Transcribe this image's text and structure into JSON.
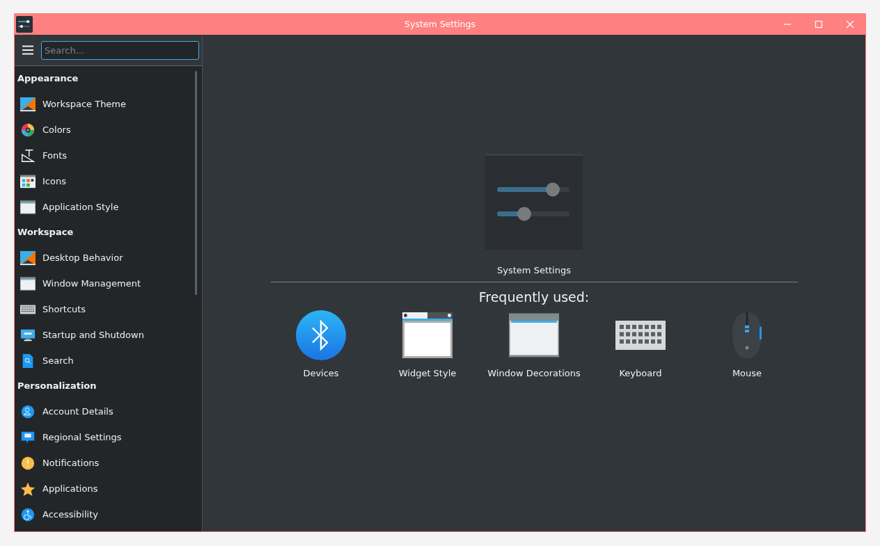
{
  "window": {
    "title": "System Settings"
  },
  "sidebar": {
    "search": {
      "placeholder": "Search..."
    },
    "sections": [
      {
        "title": "Appearance",
        "items": [
          {
            "label": "Workspace Theme",
            "kind": "theme"
          },
          {
            "label": "Colors",
            "kind": "colors"
          },
          {
            "label": "Fonts",
            "kind": "fonts"
          },
          {
            "label": "Icons",
            "kind": "icons"
          },
          {
            "label": "Application Style",
            "kind": "window"
          }
        ]
      },
      {
        "title": "Workspace",
        "items": [
          {
            "label": "Desktop Behavior",
            "kind": "theme"
          },
          {
            "label": "Window Management",
            "kind": "window"
          },
          {
            "label": "Shortcuts",
            "kind": "keyboard"
          },
          {
            "label": "Startup and Shutdown",
            "kind": "monitor"
          },
          {
            "label": "Search",
            "kind": "search"
          }
        ]
      },
      {
        "title": "Personalization",
        "items": [
          {
            "label": "Account Details",
            "kind": "account"
          },
          {
            "label": "Regional Settings",
            "kind": "chat"
          },
          {
            "label": "Notifications",
            "kind": "notify"
          },
          {
            "label": "Applications",
            "kind": "star"
          },
          {
            "label": "Accessibility",
            "kind": "access"
          }
        ]
      }
    ]
  },
  "main": {
    "app_label": "System Settings",
    "frequent_title": "Frequently used:",
    "frequent": [
      {
        "label": "Devices",
        "kind": "bluetooth"
      },
      {
        "label": "Widget Style",
        "kind": "widget"
      },
      {
        "label": "Window Decorations",
        "kind": "window"
      },
      {
        "label": "Keyboard",
        "kind": "keyboard"
      },
      {
        "label": "Mouse",
        "kind": "mouse"
      }
    ]
  }
}
